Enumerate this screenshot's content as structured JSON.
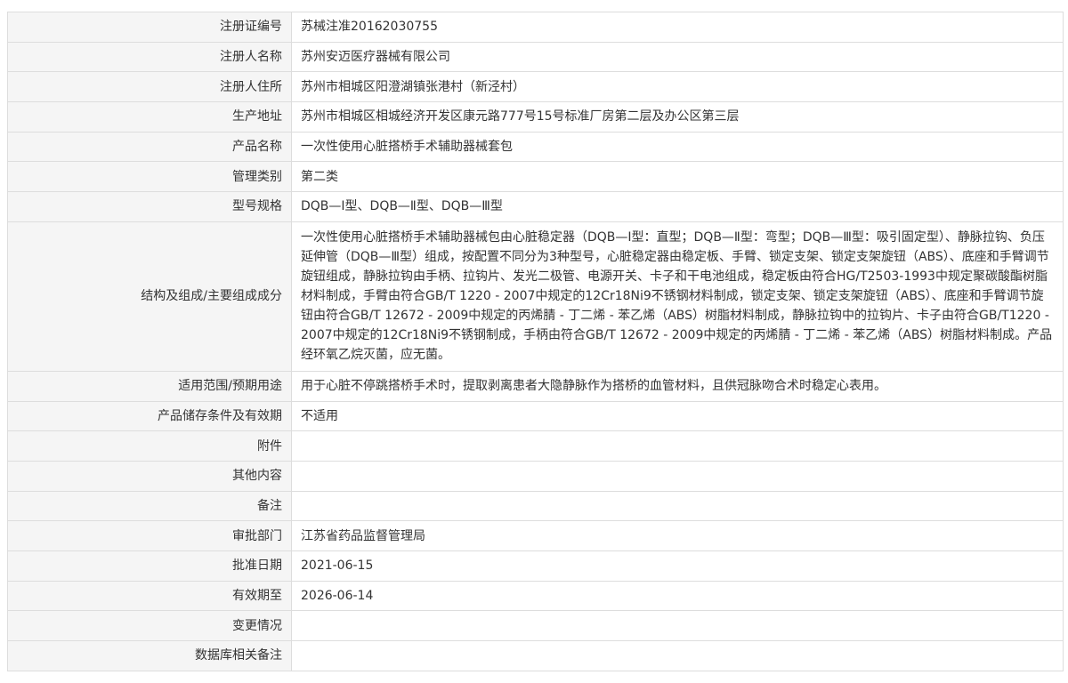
{
  "rows": [
    {
      "label": "注册证编号",
      "value": "苏械注准20162030755"
    },
    {
      "label": "注册人名称",
      "value": "苏州安迈医疗器械有限公司"
    },
    {
      "label": "注册人住所",
      "value": "苏州市相城区阳澄湖镇张港村（新泾村）"
    },
    {
      "label": "生产地址",
      "value": "苏州市相城区相城经济开发区康元路777号15号标准厂房第二层及办公区第三层"
    },
    {
      "label": "产品名称",
      "value": "一次性使用心脏搭桥手术辅助器械套包"
    },
    {
      "label": "管理类别",
      "value": "第二类"
    },
    {
      "label": "型号规格",
      "value": "DQB—Ⅰ型、DQB—Ⅱ型、DQB—Ⅲ型"
    },
    {
      "label": "结构及组成/主要组成成分",
      "value": "一次性使用心脏搭桥手术辅助器械包由心脏稳定器（DQB—Ⅰ型：直型；DQB—Ⅱ型：弯型；DQB—Ⅲ型：吸引固定型）、静脉拉钩、负压延伸管（DQB—Ⅲ型）组成，按配置不同分为3种型号，心脏稳定器由稳定板、手臂、锁定支架、锁定支架旋钮（ABS）、底座和手臂调节旋钮组成，静脉拉钩由手柄、拉钩片、发光二极管、电源开关、卡子和干电池组成，稳定板由符合HG/T2503-1993中规定聚碳酸酯树脂材料制成，手臂由符合GB/T 1220 - 2007中规定的12Cr18Ni9不锈钢材料制成，锁定支架、锁定支架旋钮（ABS）、底座和手臂调节旋钮由符合GB/T 12672 - 2009中规定的丙烯腈 - 丁二烯 - 苯乙烯（ABS）树脂材料制成，静脉拉钩中的拉钩片、卡子由符合GB/T1220 - 2007中规定的12Cr18Ni9不锈钢制成，手柄由符合GB/T 12672 - 2009中规定的丙烯腈 - 丁二烯 - 苯乙烯（ABS）树脂材料制成。产品经环氧乙烷灭菌，应无菌。"
    },
    {
      "label": "适用范围/预期用途",
      "value": "用于心脏不停跳搭桥手术时，提取剥离患者大隐静脉作为搭桥的血管材料，且供冠脉吻合术时稳定心表用。"
    },
    {
      "label": "产品储存条件及有效期",
      "value": "不适用"
    },
    {
      "label": "附件",
      "value": ""
    },
    {
      "label": "其他内容",
      "value": ""
    },
    {
      "label": "备注",
      "value": ""
    },
    {
      "label": "审批部门",
      "value": "江苏省药品监督管理局"
    },
    {
      "label": "批准日期",
      "value": "2021-06-15"
    },
    {
      "label": "有效期至",
      "value": "2026-06-14"
    },
    {
      "label": "变更情况",
      "value": ""
    },
    {
      "label": "数据库相关备注",
      "value": ""
    }
  ]
}
